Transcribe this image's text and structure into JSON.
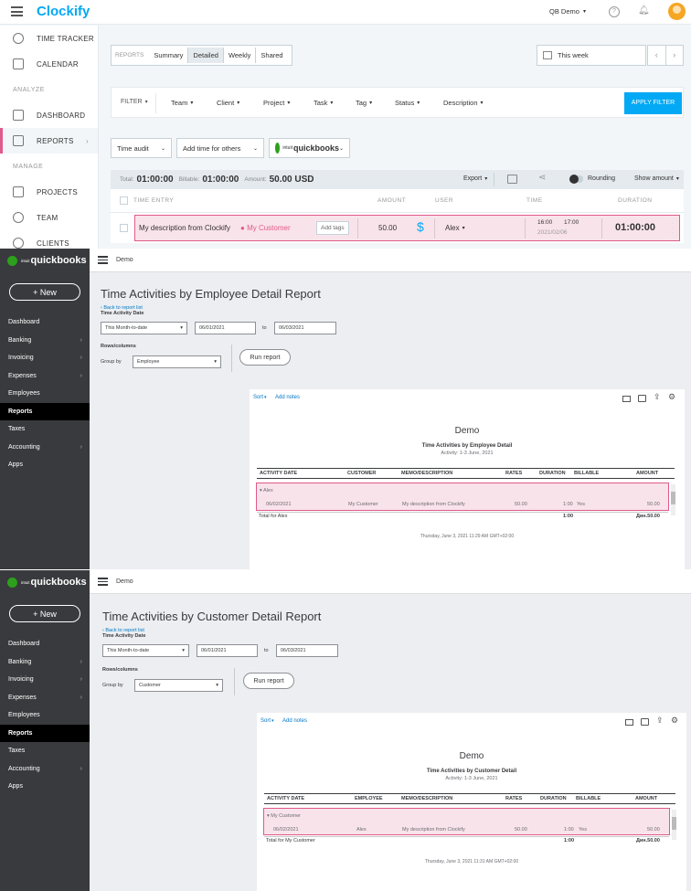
{
  "clockify": {
    "logo": "Clockify",
    "workspace": "QB Demo",
    "nav": [
      {
        "label": "TIME TRACKER",
        "icon": "clock-icon"
      },
      {
        "label": "CALENDAR",
        "icon": "calendar-icon"
      }
    ],
    "analyze_label": "ANALYZE",
    "nav_analyze": [
      {
        "label": "DASHBOARD",
        "icon": "dashboard-icon"
      },
      {
        "label": "REPORTS",
        "icon": "reports-icon"
      }
    ],
    "manage_label": "MANAGE",
    "nav_manage": [
      {
        "label": "PROJECTS",
        "icon": "projects-icon"
      },
      {
        "label": "TEAM",
        "icon": "team-icon"
      },
      {
        "label": "CLIENTS",
        "icon": "clients-icon"
      }
    ],
    "report_tabs": {
      "label": "REPORTS",
      "tabs": [
        "Summary",
        "Detailed",
        "Weekly",
        "Shared"
      ],
      "active": "Detailed"
    },
    "date_range": "This week",
    "filters": {
      "label": "FILTER",
      "items": [
        "Team",
        "Client",
        "Project",
        "Task",
        "Tag",
        "Status",
        "Description"
      ],
      "apply": "APPLY FILTER"
    },
    "actions": {
      "time_audit": "Time audit",
      "add_time": "Add time for others",
      "qb_brand": "quickbooks",
      "qb_intuit": "intuit"
    },
    "totals": {
      "total_label": "Total:",
      "total": "01:00:00",
      "billable_label": "Billable:",
      "billable": "01:00:00",
      "amount_label": "Amount:",
      "amount": "50.00 USD",
      "export": "Export",
      "rounding": "Rounding",
      "show_amount": "Show amount"
    },
    "columns": [
      "TIME ENTRY",
      "AMOUNT",
      "USER",
      "TIME",
      "DURATION"
    ],
    "entry": {
      "description": "My description from Clockify",
      "client": "My Customer",
      "add_tags": "Add tags",
      "amount": "50.00",
      "user": "Alex",
      "start": "16:00",
      "end": "17:00",
      "date": "2021/02/06",
      "duration": "01:00:00"
    }
  },
  "qb1": {
    "brand": "quickbooks",
    "intuit": "intuit",
    "new_button": "+ New",
    "nav": [
      {
        "label": "Dashboard",
        "chev": ""
      },
      {
        "label": "Banking",
        "chev": "›"
      },
      {
        "label": "Invoicing",
        "chev": "›"
      },
      {
        "label": "Expenses",
        "chev": "›"
      },
      {
        "label": "Employees",
        "chev": ""
      },
      {
        "label": "Reports",
        "chev": ""
      },
      {
        "label": "Taxes",
        "chev": ""
      },
      {
        "label": "Accounting",
        "chev": "›"
      },
      {
        "label": "Apps",
        "chev": ""
      }
    ],
    "company": "Demo",
    "title": "Time Activities by Employee Detail Report",
    "back": "Back to report list",
    "date_label": "Time Activity Date",
    "period": "This Month-to-date",
    "from": "06/01/2021",
    "to_label": "to",
    "to": "06/03/2021",
    "rows_label": "Rows/columns",
    "group_label": "Group by",
    "group": "Employee",
    "run": "Run report",
    "sort": "Sort",
    "add_notes": "Add notes",
    "report_company": "Demo",
    "report_title": "Time Activities by Employee Detail",
    "report_sub": "Activity: 1-3 June, 2021",
    "headers": [
      "ACTIVITY DATE",
      "CUSTOMER",
      "MEMO/DESCRIPTION",
      "RATES",
      "DURATION",
      "BILLABLE",
      "AMOUNT"
    ],
    "group_row": "Alex",
    "row": {
      "date": "06/02/2021",
      "party": "My Customer",
      "memo": "My description from Clockify",
      "rate": "50.00",
      "duration": "1:00",
      "billable": "Yes",
      "amount": "50.00"
    },
    "total_label": "Total for Alex",
    "total_duration": "1:00",
    "total_amount": "Дин.50.00",
    "footer": "Thursday, June 3, 2021  11:29 AM GMT+02:00"
  },
  "qb2": {
    "brand": "quickbooks",
    "intuit": "intuit",
    "new_button": "+ New",
    "nav": [
      {
        "label": "Dashboard",
        "chev": ""
      },
      {
        "label": "Banking",
        "chev": "›"
      },
      {
        "label": "Invoicing",
        "chev": "›"
      },
      {
        "label": "Expenses",
        "chev": "›"
      },
      {
        "label": "Employees",
        "chev": ""
      },
      {
        "label": "Reports",
        "chev": ""
      },
      {
        "label": "Taxes",
        "chev": ""
      },
      {
        "label": "Accounting",
        "chev": "›"
      },
      {
        "label": "Apps",
        "chev": ""
      }
    ],
    "company": "Demo",
    "title": "Time Activities by Customer Detail Report",
    "back": "Back to report list",
    "date_label": "Time Activity Date",
    "period": "This Month-to-date",
    "from": "06/01/2021",
    "to_label": "to",
    "to": "06/03/2021",
    "rows_label": "Rows/columns",
    "group_label": "Group by",
    "group": "Customer",
    "run": "Run report",
    "sort": "Sort",
    "add_notes": "Add notes",
    "report_company": "Demo",
    "report_title": "Time Activities by Customer Detail",
    "report_sub": "Activity: 1-3 June, 2021",
    "headers": [
      "ACTIVITY DATE",
      "EMPLOYEE",
      "MEMO/DESCRIPTION",
      "RATES",
      "DURATION",
      "BILLABLE",
      "AMOUNT"
    ],
    "group_row": "My Customer",
    "row": {
      "date": "06/02/2021",
      "party": "Alex",
      "memo": "My description from Clockify",
      "rate": "50.00",
      "duration": "1:00",
      "billable": "Yes",
      "amount": "50.00"
    },
    "total_label": "Total for My Customer",
    "total_duration": "1:00",
    "total_amount": "Дин.50.00",
    "footer": "Thursday, June 3, 2021  11:31 AM GMT+02:00"
  },
  "colors": {
    "clockify_blue": "#03a9f4",
    "highlight": "#e05a8a",
    "qb_green": "#2ca01c",
    "qb_sidebar": "#393a3d"
  }
}
